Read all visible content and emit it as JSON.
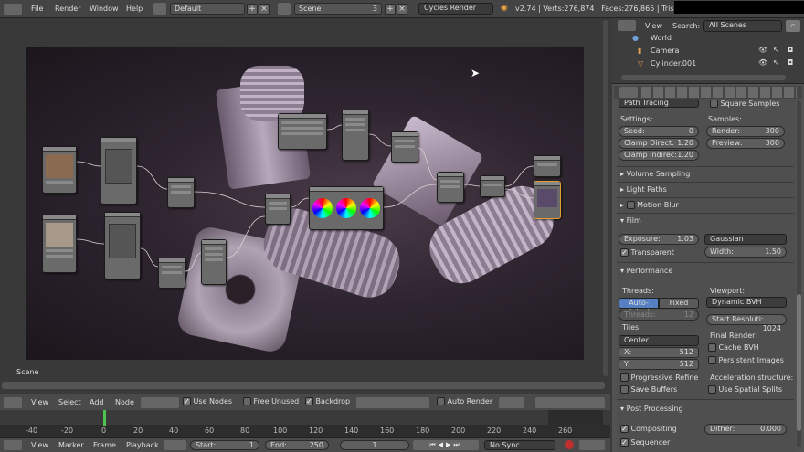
{
  "topbar": {
    "menus": [
      "File",
      "Render",
      "Window",
      "Help"
    ],
    "layout": "Default",
    "scene": "Scene",
    "scene_users": "3",
    "engine": "Cycles Render",
    "stats": "v2.74 | Verts:276,874 | Faces:276,865 | Tris:553"
  },
  "viewport": {
    "label": "Scene"
  },
  "node_header": {
    "menus": [
      "View",
      "Select",
      "Add",
      "Node"
    ],
    "use_nodes": "Use Nodes",
    "free_unused": "Free Unused",
    "backdrop": "Backdrop",
    "auto_render": "Auto Render"
  },
  "timeline": {
    "ticks": [
      "-40",
      "-20",
      "0",
      "20",
      "40",
      "60",
      "80",
      "100",
      "120",
      "140",
      "160",
      "180",
      "200",
      "220",
      "240",
      "260"
    ]
  },
  "playback": {
    "menus": [
      "View",
      "Marker",
      "Frame",
      "Playback"
    ],
    "start_label": "Start:",
    "start": "1",
    "end_label": "End:",
    "end": "250",
    "current": "1",
    "sync": "No Sync"
  },
  "outliner": {
    "menus": [
      "View",
      "Search:"
    ],
    "filter": "All Scenes",
    "items": [
      "World",
      "Camera",
      "Cylinder.001"
    ]
  },
  "render": {
    "sampling_mode": "Path Tracing",
    "square_samples": "Square Samples",
    "settings_label": "Settings:",
    "samples_label": "Samples:",
    "seed_label": "Seed:",
    "seed": "0",
    "clamp_direct_label": "Clamp Direct:",
    "clamp_direct": "1.20",
    "clamp_indirect_label": "Clamp Indirec:",
    "clamp_indirect": "1.20",
    "render_label": "Render:",
    "render_samples": "300",
    "preview_label": "Preview:",
    "preview_samples": "300",
    "volume_sampling": "Volume Sampling",
    "light_paths": "Light Paths",
    "motion_blur": "Motion Blur",
    "film": "Film",
    "exposure_label": "Exposure:",
    "exposure": "1.03",
    "filter": "Gaussian",
    "width_label": "Width:",
    "width": "1.50",
    "transparent": "Transparent",
    "performance": "Performance",
    "threads_label": "Threads:",
    "auto_detect": "Auto-detect",
    "fixed": "Fixed",
    "threads_field_label": "Threads:",
    "threads": "12",
    "tiles_label": "Tiles:",
    "tiles_order": "Center",
    "x_label": "X:",
    "x": "512",
    "y_label": "Y:",
    "y": "512",
    "progressive_refine": "Progressive Refine",
    "save_buffers": "Save Buffers",
    "viewport_label": "Viewport:",
    "viewport_bvh": "Dynamic BVH",
    "start_resolution_label": "Start Resoluti:",
    "start_resolution": "1024",
    "final_render_label": "Final Render:",
    "cache_bvh": "Cache BVH",
    "persistent_images": "Persistent Images",
    "acceleration_label": "Acceleration structure:",
    "spatial_splits": "Use Spatial Splits",
    "post_processing": "Post Processing",
    "compositing": "Compositing",
    "sequencer": "Sequencer",
    "dither_label": "Dither:",
    "dither": "0.000"
  }
}
